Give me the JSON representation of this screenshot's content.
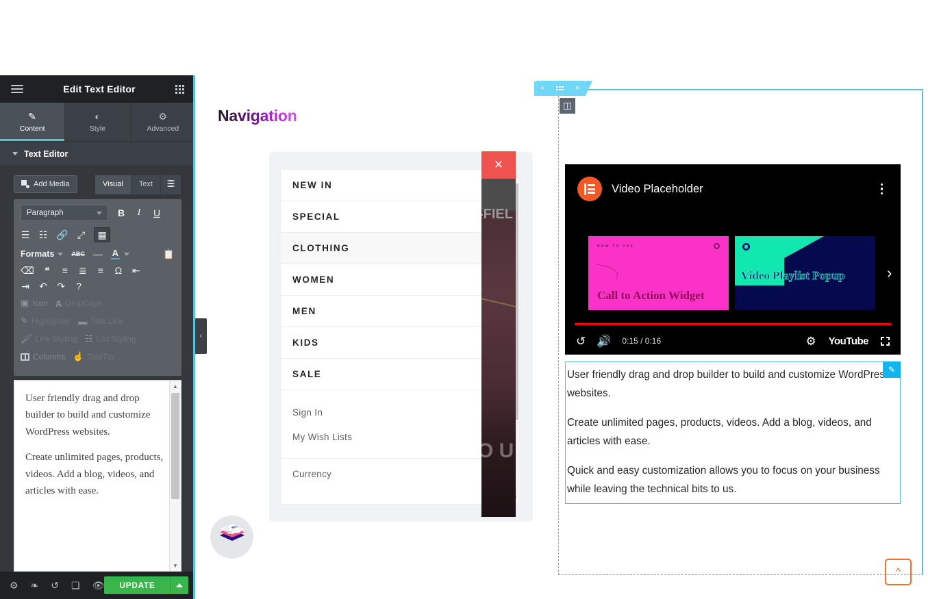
{
  "panel": {
    "header": {
      "title": "Edit Text Editor",
      "menu_icon": "hamburger-icon",
      "apps_icon": "grid-icon"
    },
    "tabs": [
      {
        "label": "Content",
        "icon": "pencil-icon",
        "active": true
      },
      {
        "label": "Style",
        "icon": "contrast-icon",
        "active": false
      },
      {
        "label": "Advanced",
        "icon": "gear-icon",
        "active": false
      }
    ],
    "section": {
      "label": "Text Editor"
    },
    "editor": {
      "add_media_label": "Add Media",
      "mode_tabs": [
        "Visual",
        "Text"
      ],
      "mode_active": "Visual",
      "format_select": "Paragraph",
      "toolbar_row1": [
        "B",
        "I",
        "U"
      ],
      "toolbar_row2": [
        "bullet-list",
        "numbered-list",
        "link",
        "fullscreen",
        "table"
      ],
      "formats_label": "Formats",
      "toolbar_row3": [
        "strikethrough",
        "horizontal-rule",
        "text-color",
        "paste-as-text"
      ],
      "toolbar_row4": [
        "clear-formatting",
        "blockquote",
        "align-left",
        "align-center",
        "align-right",
        "special-char",
        "outdent"
      ],
      "toolbar_row5": [
        "indent",
        "undo",
        "redo",
        "keyboard-shortcuts"
      ],
      "plugins": [
        {
          "label": "Icon",
          "icon": "flag-icon"
        },
        {
          "label": "DropCaps",
          "icon": "letter-a-icon"
        },
        {
          "label": "Highlighter",
          "icon": "pencil-icon"
        },
        {
          "label": "Title Line",
          "icon": "dash-icon"
        },
        {
          "label": "Link Styling",
          "icon": "brush-icon"
        },
        {
          "label": "List Styling",
          "icon": "list-icon"
        },
        {
          "label": "Columns",
          "icon": "columns-icon"
        },
        {
          "label": "ToolTip",
          "icon": "hand-icon"
        }
      ],
      "content_paragraphs": [
        "User friendly drag and drop builder to build and customize WordPress websites.",
        "Create unlimited pages, products, videos. Add a blog, videos, and articles with ease."
      ]
    },
    "footer": {
      "icons": [
        "settings-gear-icon",
        "layers-icon",
        "history-icon",
        "responsive-icon",
        "preview-eye-icon"
      ],
      "update_label": "UPDATE"
    },
    "collapse_handle": "‹"
  },
  "canvas": {
    "heading": "Navigation",
    "section_tab": {
      "add": "+",
      "drag": "drag-dots",
      "close": "×"
    },
    "menu": {
      "items": [
        {
          "label": "NEW IN",
          "chevron": false,
          "highlighted": false
        },
        {
          "label": "SPECIAL",
          "chevron": true,
          "highlighted": false
        },
        {
          "label": "CLOTHING",
          "chevron": true,
          "highlighted": true
        },
        {
          "label": "WOMEN",
          "chevron": true,
          "highlighted": false
        },
        {
          "label": "MEN",
          "chevron": true,
          "highlighted": false
        },
        {
          "label": "KIDS",
          "chevron": true,
          "highlighted": false
        },
        {
          "label": "SALE",
          "chevron": true,
          "highlighted": false
        }
      ],
      "links": [
        "Sign In",
        "My Wish Lists"
      ],
      "currency_label": "Currency",
      "chevron_glyph": "›"
    },
    "photo_text_top": "-FIEL",
    "photo_text_bottom": "O U",
    "close_button": "×",
    "logo": "layer-stack-logo"
  },
  "video": {
    "title": "Video Placeholder",
    "logo": "elementor-logo",
    "kebab": "more-options-icon",
    "thumbnails": [
      {
        "eyebrow": "HOW TO USE",
        "title": "Call to Action Widget",
        "bg": "#fb32c8"
      },
      {
        "eyebrow": "",
        "title": "Video Playlist Popup",
        "bg": "#050a4e"
      }
    ],
    "next_arrow": "›",
    "controls": {
      "replay_icon": "replay-icon",
      "volume_icon": "volume-icon",
      "time": "0:15 / 0:16",
      "settings_icon": "gear-icon",
      "brand": "YouTube",
      "fullscreen_icon": "fullscreen-icon"
    }
  },
  "text_widget": {
    "paragraphs": [
      "User friendly drag and drop builder to build and customize WordPress websites.",
      "Create unlimited pages, products, videos. Add a blog, videos, and articles with ease.",
      "Quick and easy customization allows you to focus on your business while leaving the technical bits to us."
    ],
    "edit_badge": "edit-pencil-icon"
  },
  "scroll_top": {
    "icon": "chevron-up-icon"
  },
  "colors": {
    "accent_blue": "#5bc0de",
    "update_green": "#39b54a",
    "panel_dark": "#34383c",
    "panel_darker": "#1f2124",
    "elementor_orange": "#f15a24",
    "close_red": "#ef5350",
    "scroll_top_orange": "#f0702a",
    "youtube_red": "#ff0000"
  }
}
